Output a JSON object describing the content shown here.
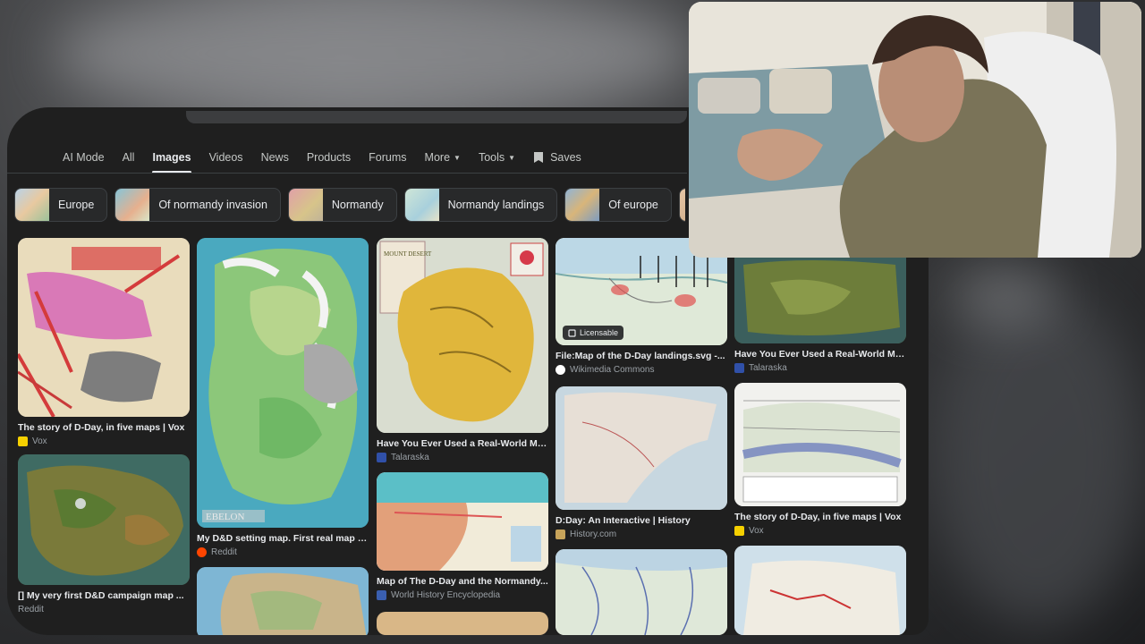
{
  "tabs": {
    "ai_mode": "AI Mode",
    "all": "All",
    "images": "Images",
    "videos": "Videos",
    "news": "News",
    "products": "Products",
    "forums": "Forums",
    "more": "More",
    "tools": "Tools",
    "saves": "Saves"
  },
  "chips": [
    "Europe",
    "Of normandy invasion",
    "Normandy",
    "Normandy landings",
    "Of europe"
  ],
  "results": [
    {
      "caption": "The story of D-Day, in five maps | Vox",
      "source": "Vox"
    },
    {
      "caption": "[] My very first D&D campaign map ...",
      "source": "Reddit"
    },
    {
      "caption": "My D&D setting map. First real map I'v...",
      "source": "Reddit",
      "map_label": "EBELON"
    },
    {
      "caption": "Have You Ever Used a Real-World Map...",
      "source": "Talaraska",
      "map_label": "MOUNT DESERT"
    },
    {
      "caption": "Map of The D-Day and the Normandy...",
      "source": "World History Encyclopedia"
    },
    {
      "caption": "File:Map of the D-Day landings.svg -...",
      "source": "Wikimedia Commons",
      "badge": "Licensable"
    },
    {
      "caption": "D:Day: An Interactive | History",
      "source": "History.com"
    },
    {
      "caption": "Have You Ever Used a Real-World Map...",
      "source": "Talaraska"
    },
    {
      "caption": "The story of D-Day, in five maps | Vox",
      "source": "Vox"
    }
  ],
  "colors": {
    "page_bg": "#1f1f1f",
    "text_primary": "#e8eaed",
    "text_secondary": "#9aa0a6",
    "vox_yellow": "#f5d000",
    "reddit_orange": "#ff4500"
  }
}
